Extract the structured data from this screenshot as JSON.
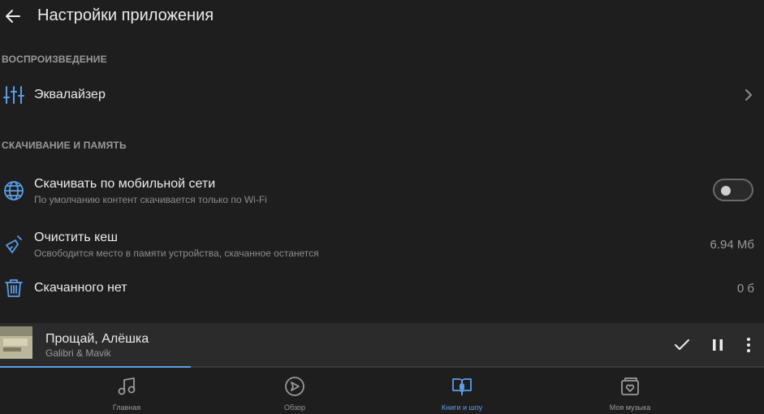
{
  "header": {
    "title": "Настройки приложения"
  },
  "sections": {
    "playback": "ВОСПРОИЗВЕДЕНИЕ",
    "storage": "СКАЧИВАНИЕ И ПАМЯТЬ"
  },
  "settings": {
    "equalizer": {
      "label": "Эквалайзер"
    },
    "mobile_download": {
      "label": "Скачивать по мобильной сети",
      "sub": "По умолчанию контент скачивается только по Wi-Fi",
      "enabled": false
    },
    "clear_cache": {
      "label": "Очистить кеш",
      "sub": "Освободится место в памяти устройства, скачанное останется",
      "value": "6.94 Мб"
    },
    "downloads": {
      "label": "Скачанного нет",
      "value": "0 б"
    }
  },
  "player": {
    "title": "Прощай, Алёшка",
    "artist": "Galibri & Mavik",
    "progress": 0.25
  },
  "nav": [
    {
      "label": "Главная",
      "icon": "music-note-icon",
      "active": false
    },
    {
      "label": "Обзор",
      "icon": "compass-icon",
      "active": false
    },
    {
      "label": "Книги и шоу",
      "icon": "book-mic-icon",
      "active": true
    },
    {
      "label": "Моя музыка",
      "icon": "heart-note-icon",
      "active": false
    }
  ],
  "colors": {
    "accent": "#5a9ee8",
    "background": "#1e1e1e",
    "player": "#2b2b2b"
  }
}
